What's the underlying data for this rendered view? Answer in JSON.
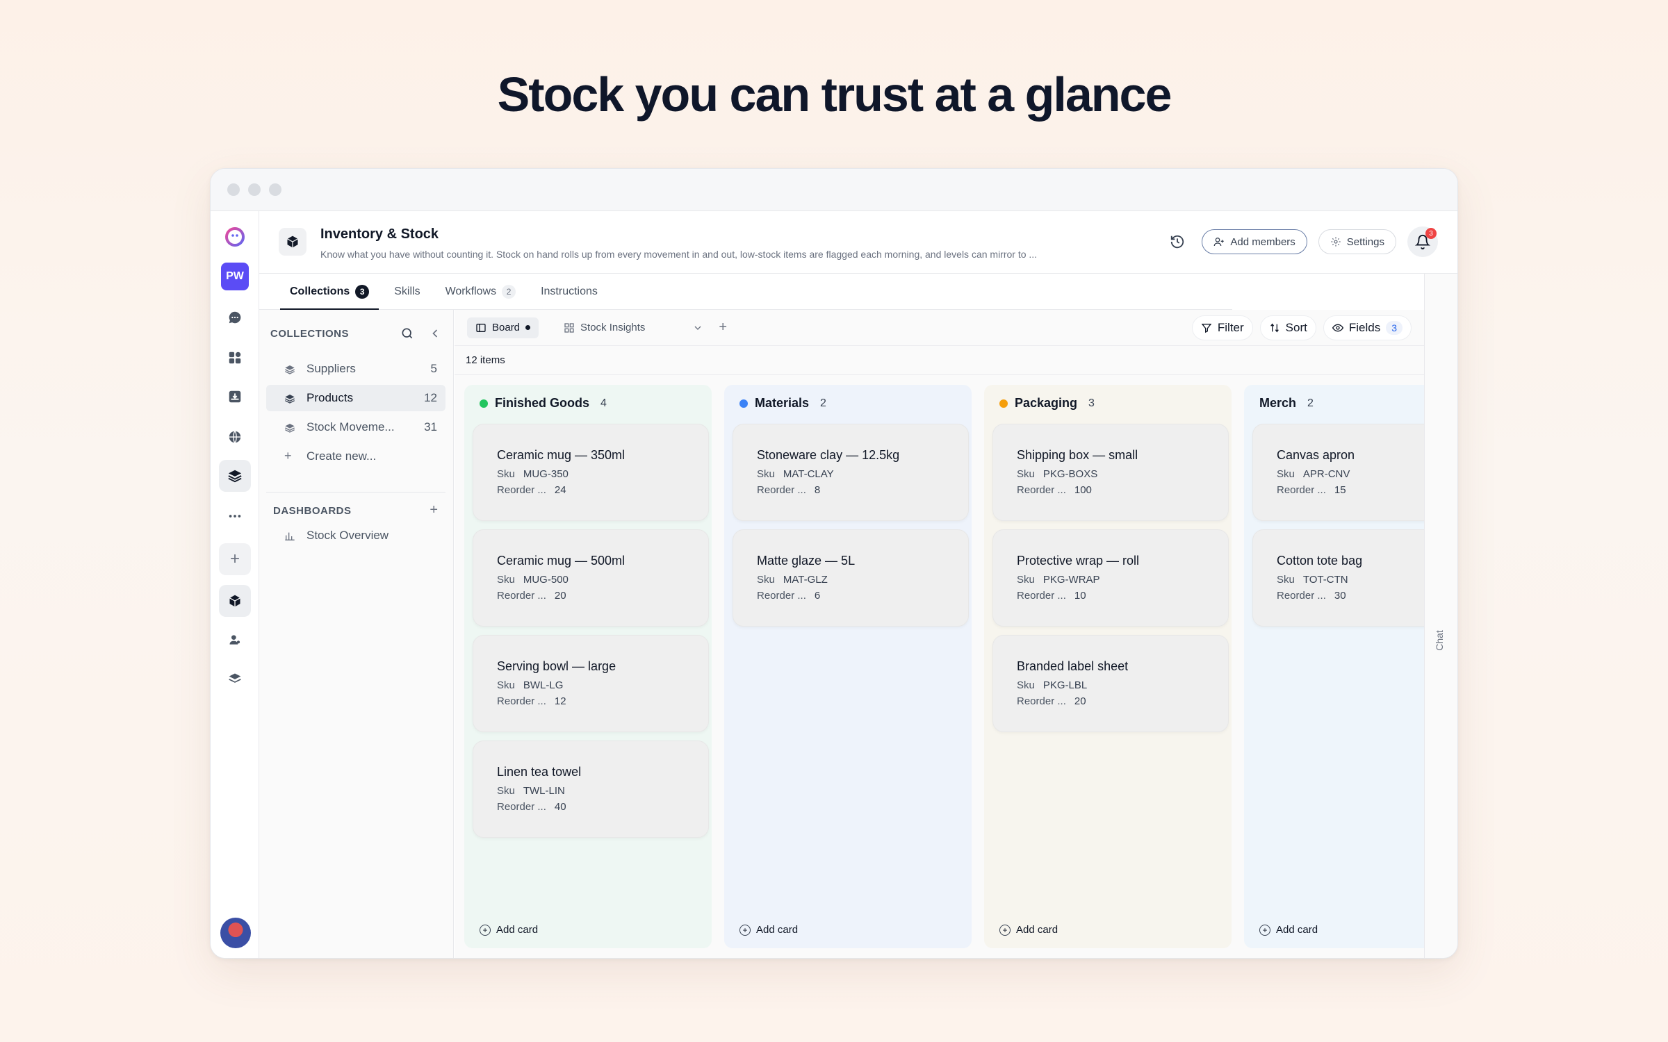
{
  "headline": "Stock you can trust at a glance",
  "rail": {
    "workspace_initials": "PW"
  },
  "header": {
    "title": "Inventory & Stock",
    "description": "Know what you have without counting it. Stock on hand rolls up from every movement in and out, low-stock items are flagged each morning, and levels can mirror to ...",
    "add_members_label": "Add members",
    "settings_label": "Settings",
    "notification_count": "3"
  },
  "tabs": [
    {
      "label": "Collections",
      "count": "3"
    },
    {
      "label": "Skills",
      "count": ""
    },
    {
      "label": "Workflows",
      "count": "2"
    },
    {
      "label": "Instructions",
      "count": ""
    }
  ],
  "sidebar": {
    "collections_heading": "COLLECTIONS",
    "items": [
      {
        "label": "Suppliers",
        "count": "5"
      },
      {
        "label": "Products",
        "count": "12"
      },
      {
        "label": "Stock Moveme...",
        "count": "31"
      }
    ],
    "create_new_label": "Create new...",
    "dashboards_heading": "DASHBOARDS",
    "dashboards": [
      {
        "label": "Stock Overview"
      }
    ]
  },
  "toolbar": {
    "board_label": "Board",
    "view_label": "Stock Insights",
    "filter_label": "Filter",
    "sort_label": "Sort",
    "fields_label": "Fields",
    "fields_count": "3"
  },
  "items_count_label": "12 items",
  "chat_label": "Chat",
  "colors": {
    "finished_goods": "#22c55e",
    "materials": "#3b82f6",
    "packaging": "#f59e0b",
    "accent": "#5b4cf5"
  },
  "board": {
    "add_card_label": "Add card",
    "columns": [
      {
        "name": "Finished Goods",
        "count": "4",
        "cards": [
          {
            "title": "Ceramic mug — 350ml",
            "sku_key": "Sku",
            "sku": "MUG-350",
            "reorder_key": "Reorder ...",
            "reorder": "24"
          },
          {
            "title": "Ceramic mug — 500ml",
            "sku_key": "Sku",
            "sku": "MUG-500",
            "reorder_key": "Reorder ...",
            "reorder": "20"
          },
          {
            "title": "Serving bowl — large",
            "sku_key": "Sku",
            "sku": "BWL-LG",
            "reorder_key": "Reorder ...",
            "reorder": "12"
          },
          {
            "title": "Linen tea towel",
            "sku_key": "Sku",
            "sku": "TWL-LIN",
            "reorder_key": "Reorder ...",
            "reorder": "40"
          }
        ]
      },
      {
        "name": "Materials",
        "count": "2",
        "cards": [
          {
            "title": "Stoneware clay — 12.5kg",
            "sku_key": "Sku",
            "sku": "MAT-CLAY",
            "reorder_key": "Reorder ...",
            "reorder": "8"
          },
          {
            "title": "Matte glaze — 5L",
            "sku_key": "Sku",
            "sku": "MAT-GLZ",
            "reorder_key": "Reorder ...",
            "reorder": "6"
          }
        ]
      },
      {
        "name": "Packaging",
        "count": "3",
        "cards": [
          {
            "title": "Shipping box — small",
            "sku_key": "Sku",
            "sku": "PKG-BOXS",
            "reorder_key": "Reorder ...",
            "reorder": "100"
          },
          {
            "title": "Protective wrap — roll",
            "sku_key": "Sku",
            "sku": "PKG-WRAP",
            "reorder_key": "Reorder ...",
            "reorder": "10"
          },
          {
            "title": "Branded label sheet",
            "sku_key": "Sku",
            "sku": "PKG-LBL",
            "reorder_key": "Reorder ...",
            "reorder": "20"
          }
        ]
      },
      {
        "name": "Merch",
        "count": "2",
        "cards": [
          {
            "title": "Canvas apron",
            "sku_key": "Sku",
            "sku": "APR-CNV",
            "reorder_key": "Reorder ...",
            "reorder": "15"
          },
          {
            "title": "Cotton tote bag",
            "sku_key": "Sku",
            "sku": "TOT-CTN",
            "reorder_key": "Reorder ...",
            "reorder": "30"
          }
        ]
      }
    ]
  }
}
